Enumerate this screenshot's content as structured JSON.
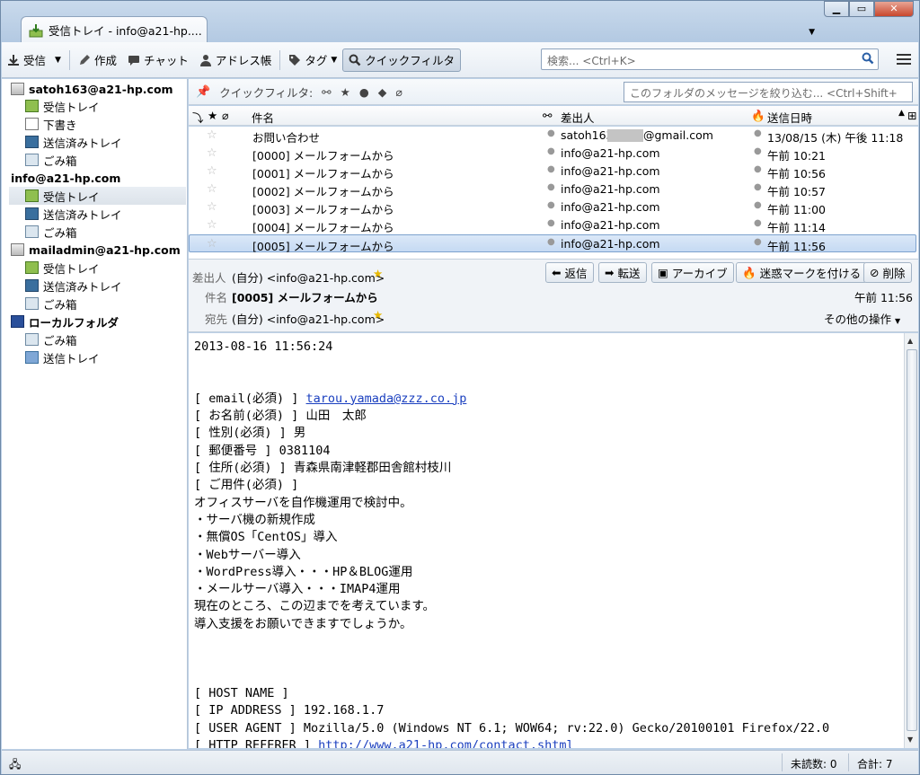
{
  "window": {
    "tab_title": "受信トレイ - info@a21-hp....",
    "min": "▁",
    "max": "▭",
    "close": "✕"
  },
  "toolbar": {
    "get_mail": "受信",
    "write": "作成",
    "chat": "チャット",
    "address_book": "アドレス帳",
    "tag": "タグ",
    "quick_filter": "クイックフィルタ",
    "search_placeholder": "検索... <Ctrl+K>"
  },
  "folders": {
    "accounts": [
      {
        "name": "satoh163@a21-hp.com",
        "folders": [
          "受信トレイ",
          "下書き",
          "送信済みトレイ",
          "ごみ箱"
        ]
      },
      {
        "name": "info@a21-hp.com",
        "folders": [
          "受信トレイ",
          "送信済みトレイ",
          "ごみ箱"
        ]
      },
      {
        "name": "mailadmin@a21-hp.com",
        "folders": [
          "受信トレイ",
          "送信済みトレイ",
          "ごみ箱"
        ]
      },
      {
        "name": "ローカルフォルダ",
        "folders": [
          "ごみ箱",
          "送信トレイ"
        ]
      }
    ]
  },
  "quickfilter": {
    "label": "クイックフィルタ:",
    "search_placeholder": "このフォルダのメッセージを絞り込む... <Ctrl+Shift+"
  },
  "columns": {
    "subject": "件名",
    "sender": "差出人",
    "date": "送信日時"
  },
  "messages": [
    {
      "subject": "お問い合わせ",
      "sender_a": "satoh163",
      "sender_b": "@gmail.com",
      "date": "13/08/15 (木) 午後 11:18"
    },
    {
      "subject": "[0000] メールフォームから",
      "sender_a": "info@a21-hp.com",
      "sender_b": "",
      "date": "午前 10:21"
    },
    {
      "subject": "[0001] メールフォームから",
      "sender_a": "info@a21-hp.com",
      "sender_b": "",
      "date": "午前 10:56"
    },
    {
      "subject": "[0002] メールフォームから",
      "sender_a": "info@a21-hp.com",
      "sender_b": "",
      "date": "午前 10:57"
    },
    {
      "subject": "[0003] メールフォームから",
      "sender_a": "info@a21-hp.com",
      "sender_b": "",
      "date": "午前 11:00"
    },
    {
      "subject": "[0004] メールフォームから",
      "sender_a": "info@a21-hp.com",
      "sender_b": "",
      "date": "午前 11:14"
    },
    {
      "subject": "[0005] メールフォームから",
      "sender_a": "info@a21-hp.com",
      "sender_b": "",
      "date": "午前 11:56"
    }
  ],
  "header": {
    "from_label": "差出人",
    "from_value": "(自分) <info@a21-hp.com>",
    "subject_label": "件名",
    "subject_value": "[0005] メールフォームから",
    "to_label": "宛先",
    "to_value": "(自分) <info@a21-hp.com>",
    "time": "午前 11:56",
    "more_actions": "その他の操作",
    "reply": "返信",
    "forward": "転送",
    "archive": "アーカイブ",
    "junk": "迷惑マークを付ける",
    "delete": "削除"
  },
  "body": {
    "date_line": "2013-08-16 11:56:24",
    "email_label": "[ email(必須) ] ",
    "email_value": "tarou.yamada@zzz.co.jp",
    "lines": [
      "[ お名前(必須) ] 山田　太郎",
      "[ 性別(必須) ] 男",
      "[ 郵便番号 ] 0381104",
      "[ 住所(必須) ] 青森県南津軽郡田舎館村枝川",
      "[ ご用件(必須) ]",
      "オフィスサーバを自作機運用で検討中。",
      "・サーバ機の新規作成",
      "・無償OS「CentOS」導入",
      "・Webサーバー導入",
      "・WordPress導入・・・HP＆BLOG運用",
      "・メールサーバ導入・・・IMAP4運用",
      "現在のところ、この辺までを考えています。",
      "導入支援をお願いできますでしょうか。"
    ],
    "host_name": "[ HOST NAME ]",
    "ip_address": "[ IP ADDRESS ] 192.168.1.7",
    "user_agent": "[ USER AGENT ] Mozilla/5.0 (Windows NT 6.1; WOW64; rv:22.0) Gecko/20100101 Firefox/22.0",
    "referer_label": "[ HTTP REFERER ] ",
    "referer_value": "http://www.a21-hp.com/contact.shtml"
  },
  "status": {
    "unread": "未読数: 0",
    "total": "合計: 7"
  },
  "colors": {
    "accent": "#3d6fb0",
    "selection": "#c5daf3",
    "link": "#1a3fbf"
  }
}
